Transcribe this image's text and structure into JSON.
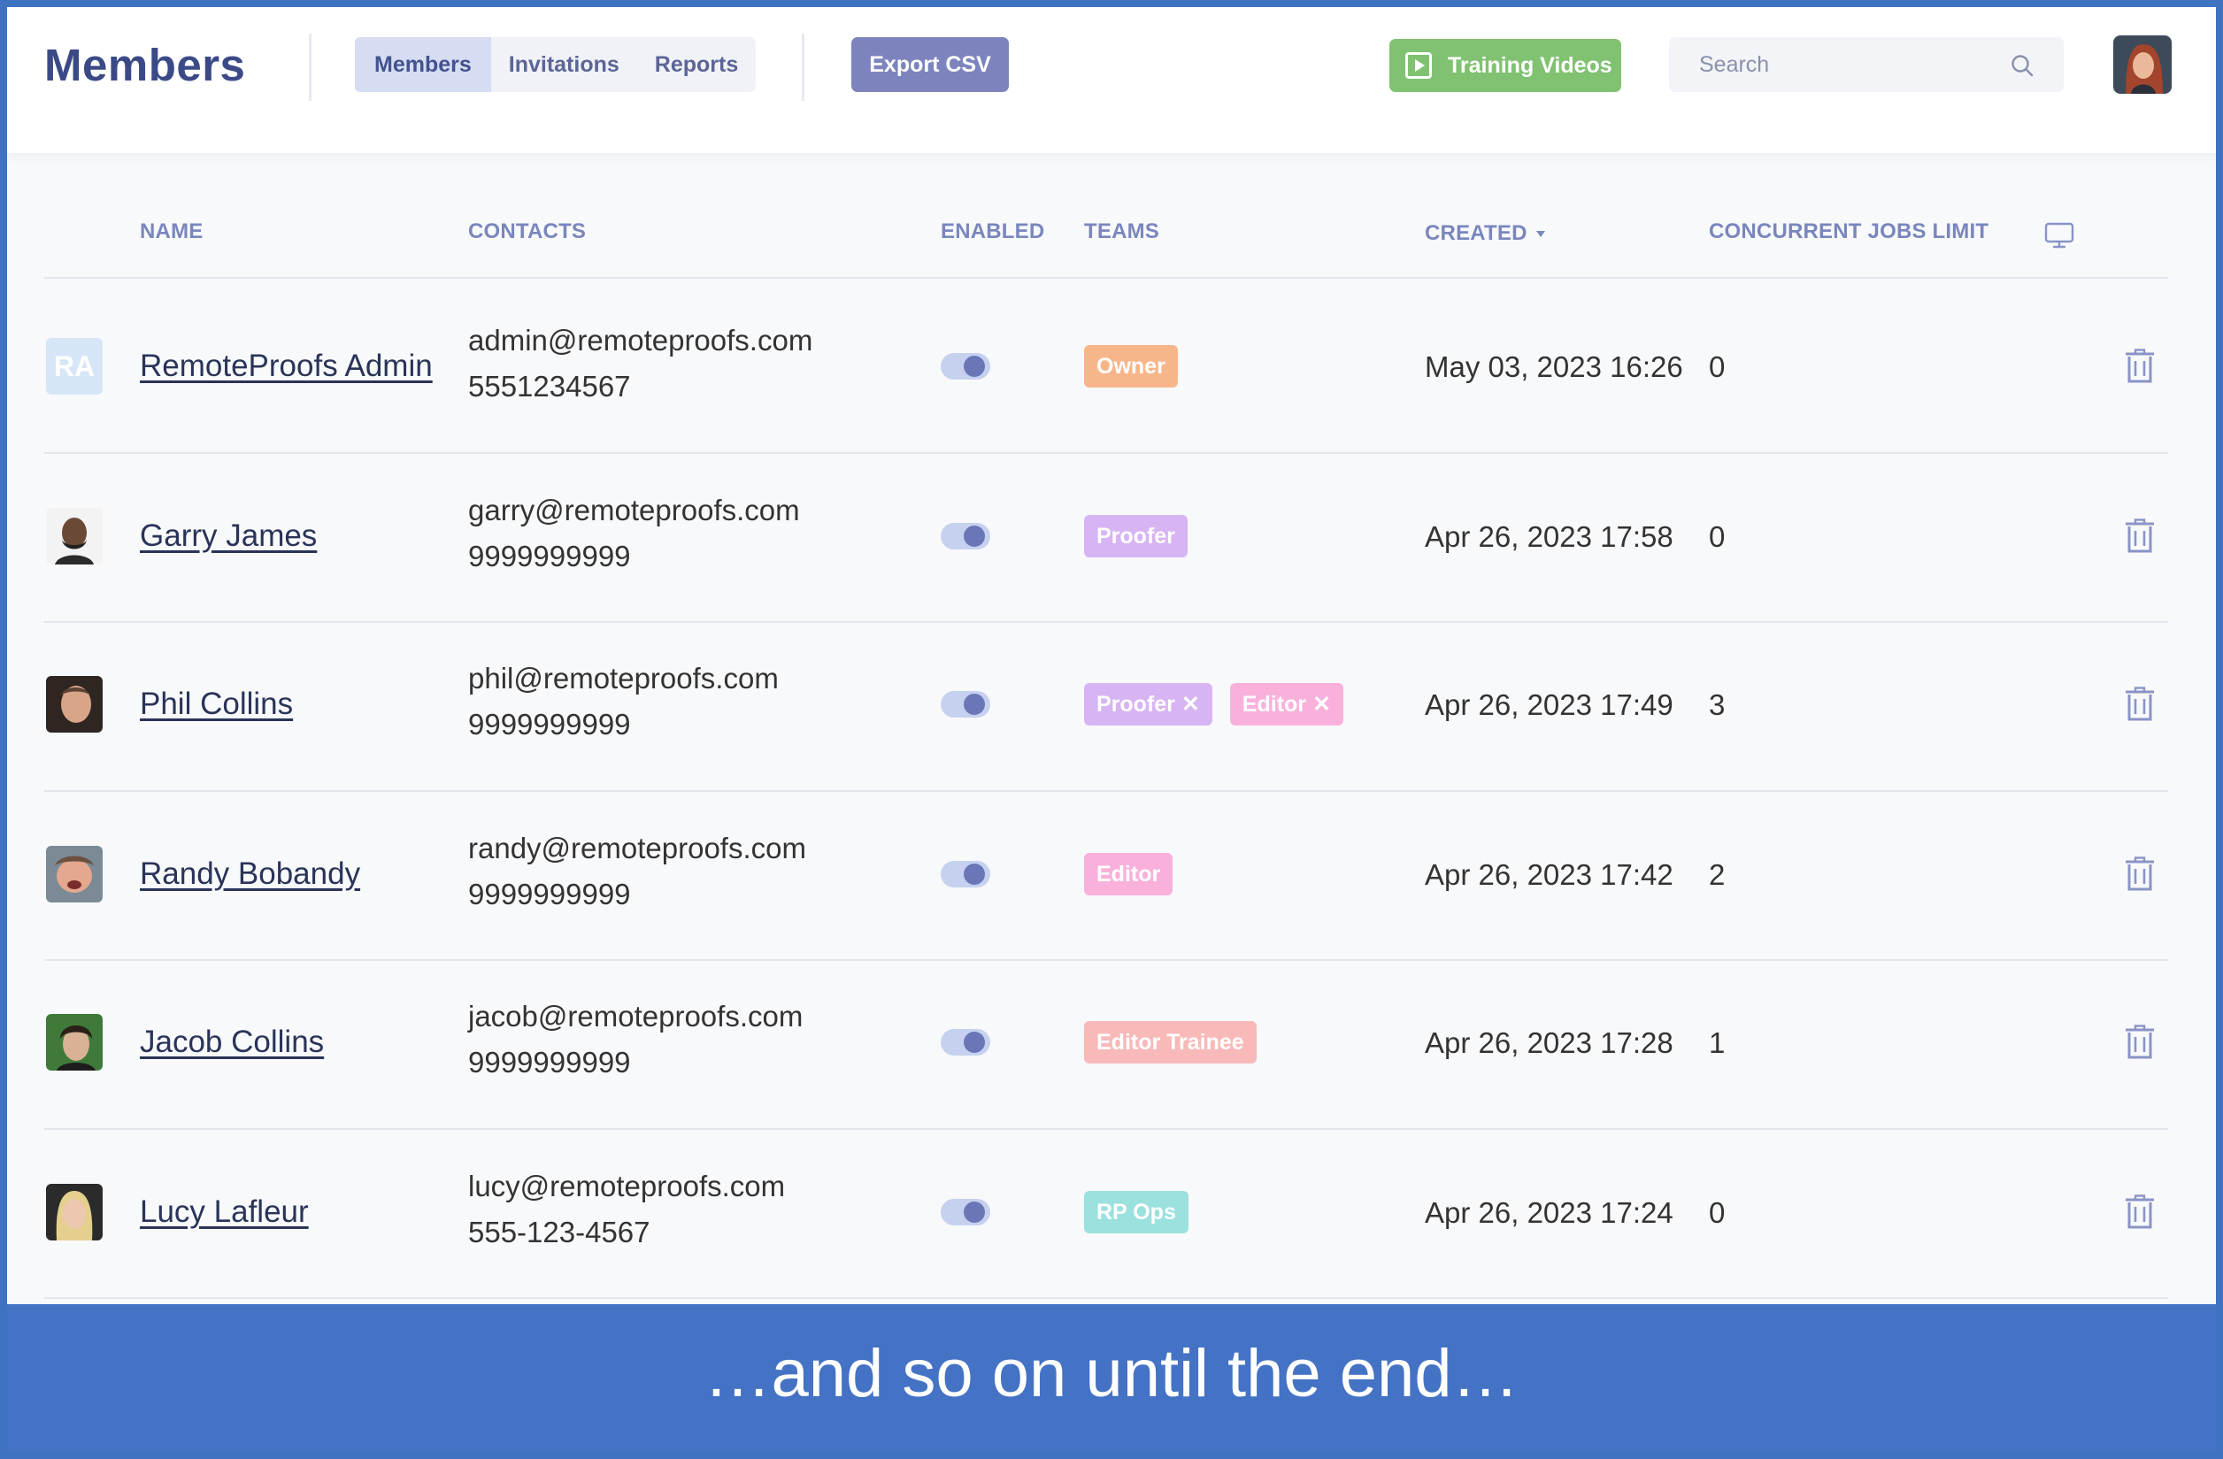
{
  "header": {
    "title": "Members",
    "tabs": [
      "Members",
      "Invitations",
      "Reports"
    ],
    "active_tab": "Members",
    "export_label": "Export CSV",
    "training_label": "Training Videos",
    "search_placeholder": "Search"
  },
  "table": {
    "columns": {
      "name": "NAME",
      "contacts": "CONTACTS",
      "enabled": "ENABLED",
      "teams": "TEAMS",
      "created": "CREATED",
      "jobs": "CONCURRENT JOBS LIMIT"
    },
    "sort_column": "CREATED",
    "rows": [
      {
        "initials": "RA",
        "name": "RemoteProofs Admin",
        "email": "admin@remoteproofs.com",
        "phone": "5551234567",
        "enabled": true,
        "teams": [
          "Owner"
        ],
        "created": "May 03, 2023 16:26",
        "jobs": "0"
      },
      {
        "name": "Garry James",
        "email": "garry@remoteproofs.com",
        "phone": "9999999999",
        "enabled": true,
        "teams": [
          "Proofer"
        ],
        "created": "Apr 26, 2023 17:58",
        "jobs": "0"
      },
      {
        "name": "Phil Collins",
        "email": "phil@remoteproofs.com",
        "phone": "9999999999",
        "enabled": true,
        "teams": [
          "Proofer ✕",
          "Editor ✕"
        ],
        "created": "Apr 26, 2023 17:49",
        "jobs": "3"
      },
      {
        "name": "Randy Bobandy",
        "email": "randy@remoteproofs.com",
        "phone": "9999999999",
        "enabled": true,
        "teams": [
          "Editor"
        ],
        "created": "Apr 26, 2023 17:42",
        "jobs": "2"
      },
      {
        "name": "Jacob Collins",
        "email": "jacob@remoteproofs.com",
        "phone": "9999999999",
        "enabled": true,
        "teams": [
          "Editor Trainee"
        ],
        "created": "Apr 26, 2023 17:28",
        "jobs": "1"
      },
      {
        "name": "Lucy Lafleur",
        "email": "lucy@remoteproofs.com",
        "phone": "555-123-4567",
        "enabled": true,
        "teams": [
          "RP Ops"
        ],
        "created": "Apr 26, 2023 17:24",
        "jobs": "0"
      }
    ]
  },
  "badge_colors": {
    "Owner": "#f7b68a",
    "Proofer": "#d7b4f3",
    "Editor": "#f9b1dc",
    "Editor Trainee": "#f8b9b9",
    "RP Ops": "#9be1de"
  },
  "colors": {
    "frame_border": "#3f72c0",
    "banner": "#4472c4",
    "title": "#3b4a86",
    "export_button": "#7d84bd",
    "training_button": "#80c271",
    "header_text": "#7a86bd"
  },
  "icons": {
    "search": "search-icon",
    "monitor": "monitor-icon",
    "trash": "trash-icon",
    "play": "play-icon"
  },
  "banner": {
    "text": "…and so on until the end…"
  }
}
